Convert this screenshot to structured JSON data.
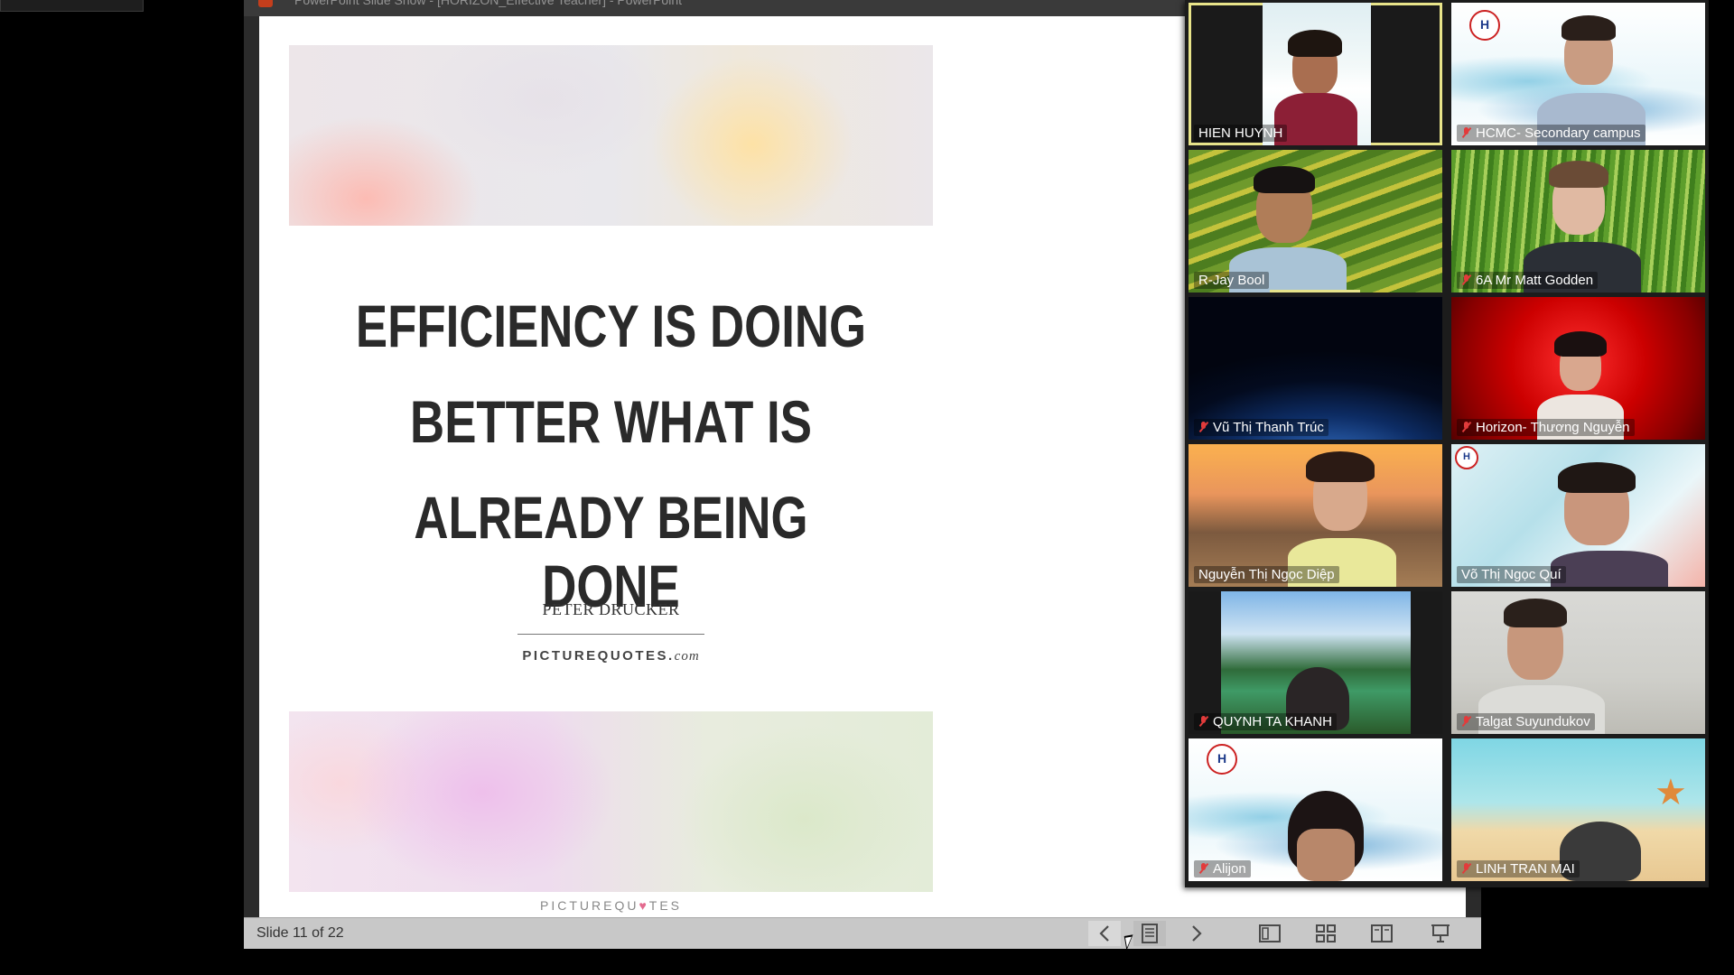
{
  "powerpoint": {
    "title": "PowerPoint Slide Show - [HORIZON_Effective Teacher] - PowerPoint",
    "slide": {
      "quote_lines": [
        "EFFICIENCY IS DOING",
        "BETTER WHAT IS",
        "ALREADY BEING DONE"
      ],
      "author": "PETER DRUCKER",
      "brand_main": "PICTUREQUOTES.",
      "brand_suffix": "com",
      "footer_brand_a": "PICTUREQU",
      "footer_brand_heart": "♥",
      "footer_brand_b": "TES"
    },
    "status_bar": {
      "slide_counter": "Slide 11 of 22",
      "prev_icon": "chevron-left-icon",
      "notes_icon": "notes-icon",
      "next_icon": "chevron-right-icon",
      "normal_view_icon": "normal-view-icon",
      "slide_sorter_icon": "slide-sorter-icon",
      "reading_view_icon": "reading-view-icon",
      "slideshow_icon": "slideshow-icon"
    }
  },
  "gallery": {
    "participants": [
      {
        "name": "HIEN HUYNH",
        "muted": false,
        "active": true
      },
      {
        "name": "HCMC- Secondary campus",
        "muted": true,
        "active": false
      },
      {
        "name": "R-Jay Bool",
        "muted": false,
        "active": false
      },
      {
        "name": "6A Mr Matt Godden",
        "muted": true,
        "active": false
      },
      {
        "name": "Vũ Thị Thanh Trúc",
        "muted": true,
        "active": false
      },
      {
        "name": "Horizon- Thương Nguyễn",
        "muted": true,
        "active": false
      },
      {
        "name": "Nguyễn Thị Ngọc Diệp",
        "muted": false,
        "active": false
      },
      {
        "name": "Võ Thị Ngọc Quí",
        "muted": false,
        "active": false
      },
      {
        "name": "QUYNH TA KHANH",
        "muted": true,
        "active": false
      },
      {
        "name": "Talgat Suyundukov",
        "muted": true,
        "active": false
      },
      {
        "name": "Alijon",
        "muted": true,
        "active": false
      },
      {
        "name": "LINH TRAN MAI",
        "muted": true,
        "active": false
      }
    ],
    "logo_letter": "H",
    "colors": {
      "active_border": "#e8e48a",
      "muted_mic": "#e23b3b"
    }
  }
}
